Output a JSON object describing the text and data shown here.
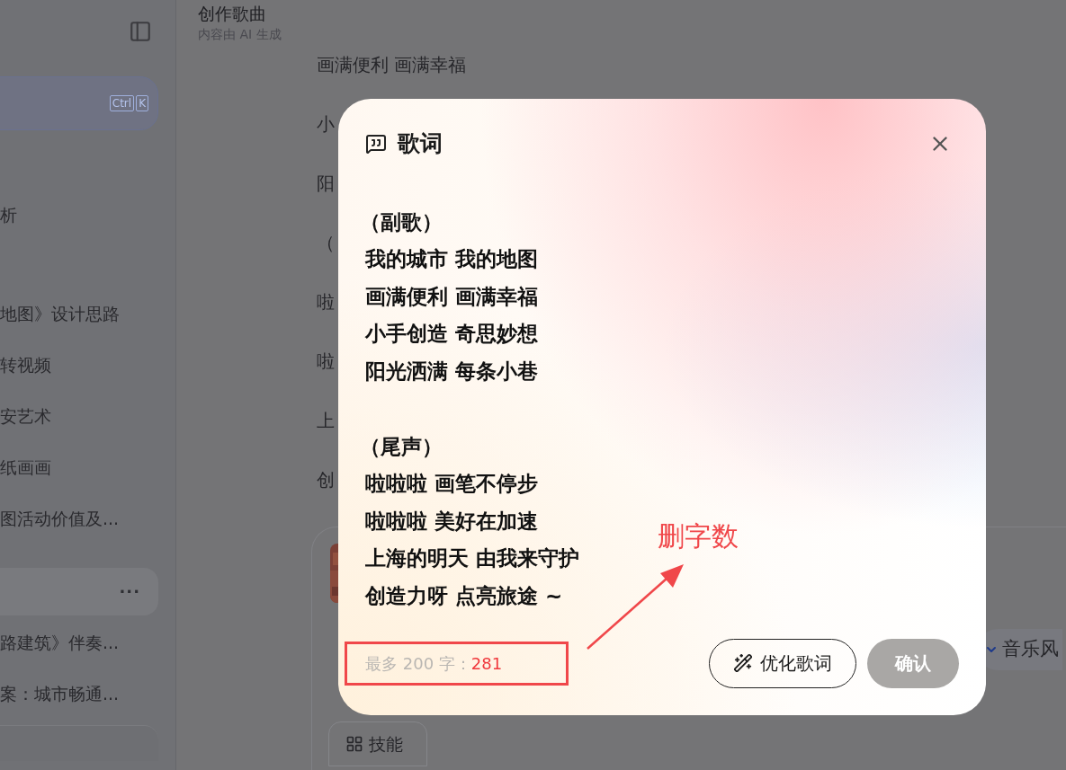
{
  "sidebar": {
    "search": {
      "keys": [
        "Ctrl",
        "K"
      ]
    },
    "items": [
      {
        "label": "析"
      },
      {
        "label": "地图》设计思路"
      },
      {
        "label": "转视频"
      },
      {
        "label": "安艺术"
      },
      {
        "label": "纸画画"
      },
      {
        "label": "图活动价值及..."
      },
      {
        "kind": "hovered",
        "more": "···"
      },
      {
        "label": "路建筑》伴奏..."
      },
      {
        "label": "案：城市畅通..."
      }
    ]
  },
  "header": {
    "title": "创作歌曲",
    "subtitle": "内容由 AI 生成"
  },
  "background_lyrics": [
    "画满便利 画满幸福",
    "小",
    "阳",
    "（",
    "啦",
    "啦",
    "上",
    "创"
  ],
  "composer": {
    "style_label": "音乐风",
    "skills_button": "技能"
  },
  "dialog": {
    "title": "歌词",
    "sections": [
      {
        "heading": "（副歌）",
        "lines": [
          "我的城市 我的地图",
          "画满便利 画满幸福",
          "小手创造 奇思妙想",
          "阳光洒满 每条小巷"
        ]
      },
      {
        "heading": "（尾声）",
        "lines": [
          "啦啦啦 画笔不停步",
          "啦啦啦 美好在加速",
          "上海的明天 由我来守护",
          "创造力呀 点亮旅途 ~"
        ]
      }
    ],
    "limit_label": "最多 200 字：",
    "count": "281",
    "buttons": [
      {
        "label": "优化歌词",
        "kind": "outline",
        "disabled": false
      },
      {
        "label": "确认",
        "kind": "primary",
        "disabled": true
      }
    ]
  },
  "annotation": {
    "text": "删字数"
  }
}
